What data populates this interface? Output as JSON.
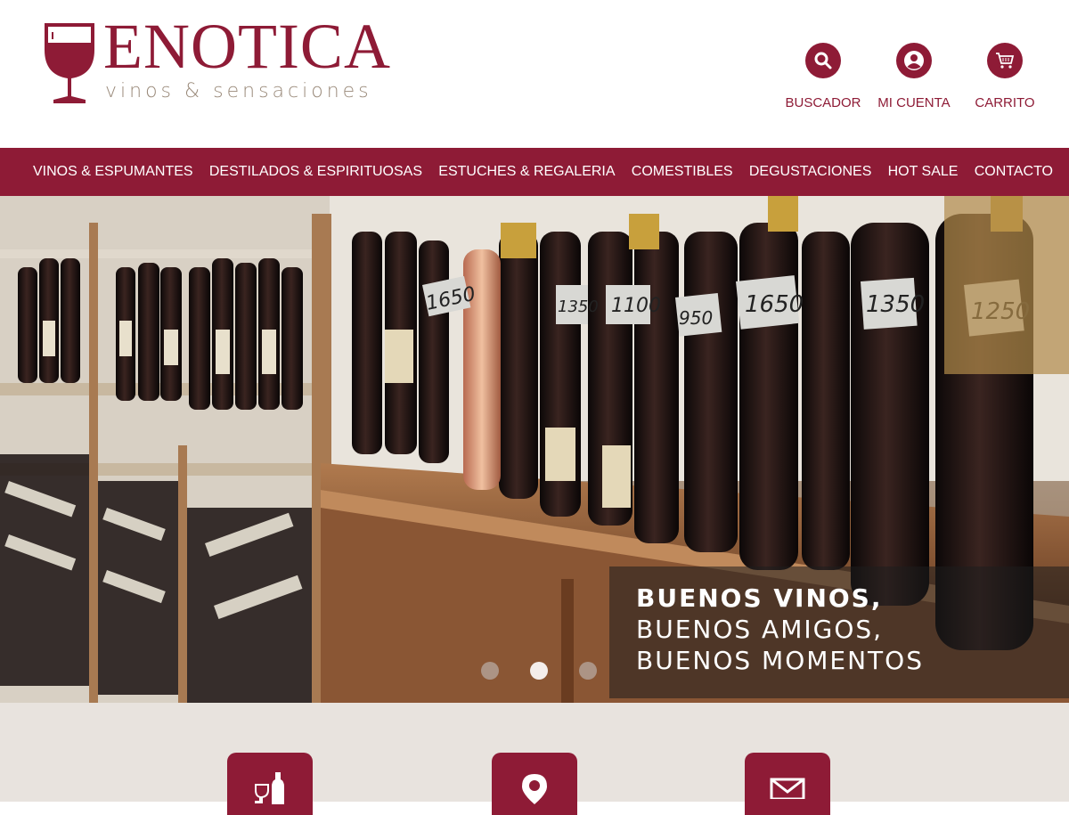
{
  "brand": {
    "name": "ENOTICA",
    "tagline": "vinos & sensaciones",
    "primary_color": "#8e1b36"
  },
  "header_actions": [
    {
      "label": "BUSCADOR",
      "icon": "search-icon"
    },
    {
      "label": "MI CUENTA",
      "icon": "user-icon"
    },
    {
      "label": "CARRITO",
      "icon": "cart-icon"
    }
  ],
  "nav": {
    "items": [
      {
        "label": "VINOS & ESPUMANTES"
      },
      {
        "label": "DESTILADOS & ESPIRITUOSAS"
      },
      {
        "label": "ESTUCHES & REGALERIA"
      },
      {
        "label": "COMESTIBLES"
      },
      {
        "label": "DEGUSTACIONES"
      },
      {
        "label": "HOT SALE"
      },
      {
        "label": "CONTACTO"
      }
    ]
  },
  "hero": {
    "caption": {
      "line1": "BUENOS VINOS,",
      "line2": "BUENOS AMIGOS,",
      "line3": "BUENOS MOMENTOS"
    },
    "price_tags": [
      "1650",
      "1350",
      "1100",
      "950",
      "1650",
      "1350",
      "1250"
    ],
    "slides_total": 3,
    "active_slide": 2
  },
  "features": [
    {
      "icon": "wine-bottle-icon"
    },
    {
      "icon": "location-pin-icon"
    },
    {
      "icon": "mail-icon"
    }
  ]
}
